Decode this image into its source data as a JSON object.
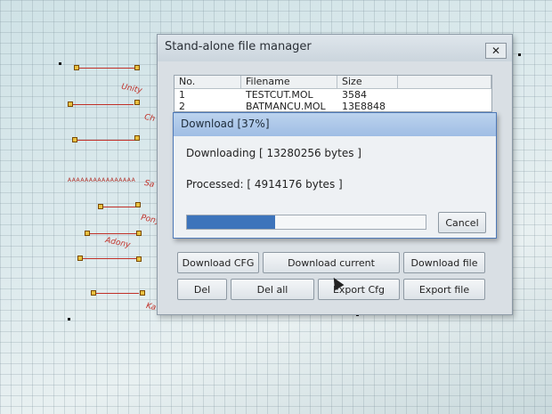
{
  "window": {
    "title": "Stand-alone file manager",
    "close_glyph": "✕",
    "table": {
      "columns": [
        "No.",
        "Filename",
        "Size"
      ],
      "rows": [
        {
          "no": "1",
          "filename": "TESTCUT.MOL",
          "size": "3584"
        },
        {
          "no": "2",
          "filename": "BATMANCU.MOL",
          "size": "13E8848"
        }
      ]
    },
    "buttons": {
      "download_cfg": "Download CFG",
      "download_current": "Download current",
      "download_file": "Download file",
      "del": "Del",
      "del_all": "Del all",
      "export_cfg": "Export Cfg",
      "export_file": "Export file"
    }
  },
  "dialog": {
    "title": "Download [37%]",
    "downloading_text": "Downloading [ 13280256 bytes ]",
    "processed_text": "Processed: [ 4914176 bytes ]",
    "progress_percent": 37,
    "cancel_label": "Cancel"
  },
  "background": {
    "labels": [
      "Unity",
      "Ch",
      "Sa",
      "Pony",
      "Adony",
      "Ka"
    ],
    "strip_text": "AAAAAAAAAAAAAAAA"
  },
  "colors": {
    "progress_fill": "#3d74bb",
    "dialog_border": "#4e79b8",
    "cad_red": "#c03028"
  }
}
